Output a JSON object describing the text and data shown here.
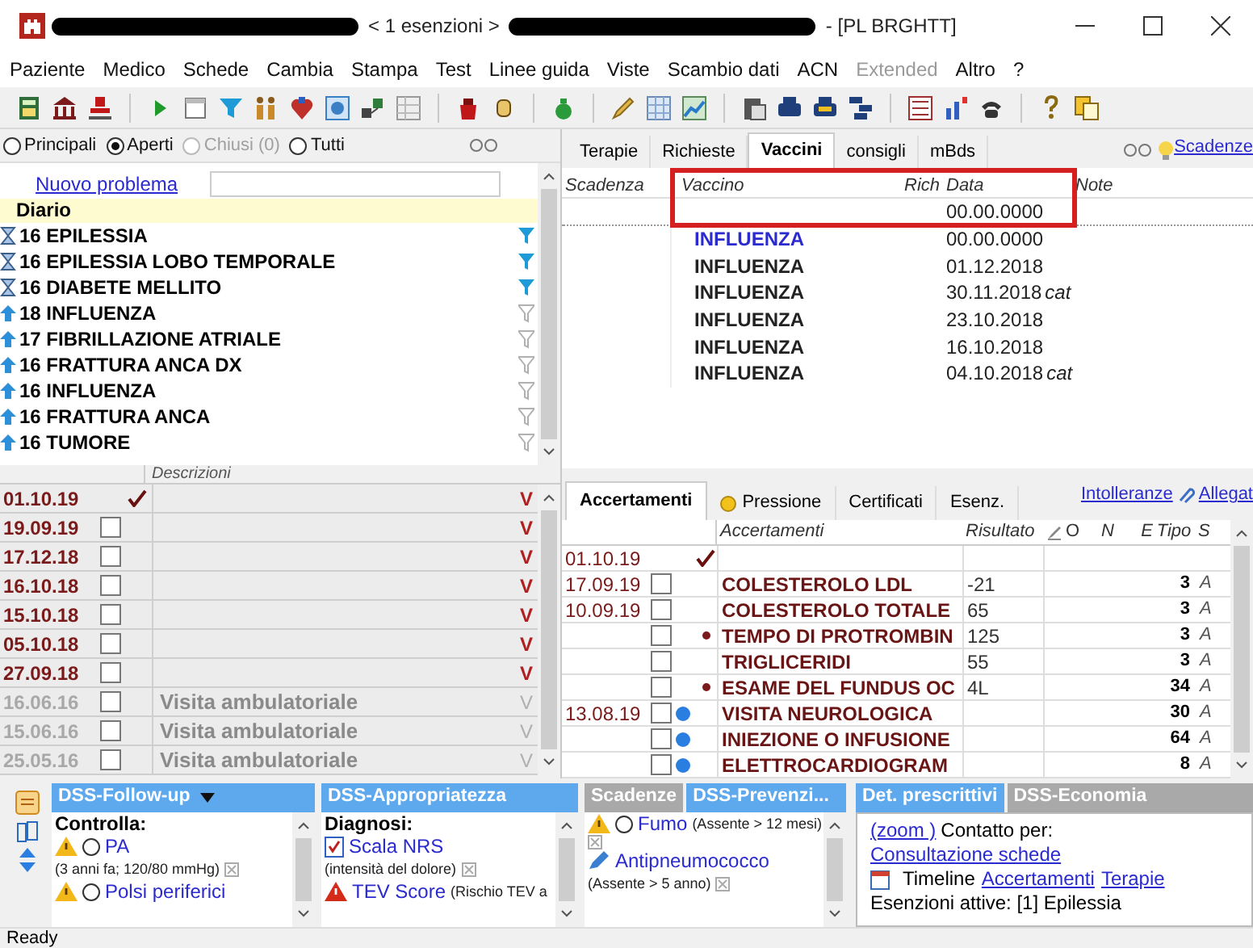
{
  "title_bar": {
    "parts": [
      {
        "kind": "redacted"
      },
      {
        "kind": "text",
        "text": "< 1 esenzioni >"
      },
      {
        "kind": "redacted"
      },
      {
        "kind": "text",
        "text": "- [PL BRGHTT]"
      }
    ]
  },
  "menu": [
    {
      "label": "Paziente",
      "disabled": false
    },
    {
      "label": "Medico",
      "disabled": false
    },
    {
      "label": "Schede",
      "disabled": false
    },
    {
      "label": "Cambia",
      "disabled": false
    },
    {
      "label": "Stampa",
      "disabled": false
    },
    {
      "label": "Test",
      "disabled": false
    },
    {
      "label": "Linee guida",
      "disabled": false
    },
    {
      "label": "Viste",
      "disabled": false
    },
    {
      "label": "Scambio dati",
      "disabled": false
    },
    {
      "label": "ACN",
      "disabled": false
    },
    {
      "label": "Extended",
      "disabled": true
    },
    {
      "label": "Altro",
      "disabled": false
    },
    {
      "label": "?",
      "disabled": false
    }
  ],
  "filters": [
    {
      "label": "Principali",
      "selected": false,
      "disabled": false
    },
    {
      "label": "Aperti",
      "selected": true,
      "disabled": false
    },
    {
      "label": "Chiusi (0)",
      "selected": false,
      "disabled": true
    },
    {
      "label": "Tutti",
      "selected": false,
      "disabled": false
    }
  ],
  "problems": {
    "new_link": "Nuovo problema",
    "diary": "Diario",
    "items": [
      {
        "kind": "hourglass",
        "text": "16 EPILESSIA",
        "filter": true
      },
      {
        "kind": "hourglass",
        "text": "16 EPILESSIA LOBO TEMPORALE",
        "filter": true
      },
      {
        "kind": "hourglass",
        "text": "16 DIABETE MELLITO",
        "filter": true
      },
      {
        "kind": "arrow",
        "text": "18 INFLUENZA",
        "filter": false
      },
      {
        "kind": "arrow",
        "text": "17 FIBRILLAZIONE ATRIALE",
        "filter": false
      },
      {
        "kind": "arrow",
        "text": "16 FRATTURA ANCA DX",
        "filter": false
      },
      {
        "kind": "arrow",
        "text": "16 INFLUENZA",
        "filter": false
      },
      {
        "kind": "arrow",
        "text": "16 FRATTURA ANCA",
        "filter": false
      },
      {
        "kind": "arrow",
        "text": "16 TUMORE",
        "filter": false
      }
    ]
  },
  "diary": {
    "column": "Descrizioni",
    "rows": [
      {
        "date": "01.10.19",
        "checked": true,
        "dimmed": false,
        "description": "",
        "flag": "V"
      },
      {
        "date": "19.09.19",
        "checked": false,
        "dimmed": false,
        "description": "",
        "flag": "V"
      },
      {
        "date": "17.12.18",
        "checked": false,
        "dimmed": false,
        "description": "",
        "flag": "V"
      },
      {
        "date": "16.10.18",
        "checked": false,
        "dimmed": false,
        "description": "",
        "flag": "V"
      },
      {
        "date": "15.10.18",
        "checked": false,
        "dimmed": false,
        "description": "",
        "flag": "V"
      },
      {
        "date": "05.10.18",
        "checked": false,
        "dimmed": false,
        "description": "",
        "flag": "V"
      },
      {
        "date": "27.09.18",
        "checked": false,
        "dimmed": false,
        "description": "",
        "flag": "V"
      },
      {
        "date": "16.06.16",
        "checked": false,
        "dimmed": true,
        "description": "Visita ambulatoriale",
        "flag": "V"
      },
      {
        "date": "15.06.16",
        "checked": false,
        "dimmed": true,
        "description": "Visita ambulatoriale",
        "flag": "V"
      },
      {
        "date": "25.05.16",
        "checked": false,
        "dimmed": true,
        "description": "Visita ambulatoriale",
        "flag": "V"
      }
    ]
  },
  "top_tabs": [
    {
      "label": "Terapie",
      "selected": false
    },
    {
      "label": "Richieste",
      "selected": false
    },
    {
      "label": "Vaccini",
      "selected": true
    },
    {
      "label": "consigli",
      "selected": false
    },
    {
      "label": "mBds",
      "selected": false
    }
  ],
  "deadlines_link": "Scadenze",
  "vaccines": {
    "columns": [
      "Scadenza",
      "Vaccino",
      "Rich",
      "Data",
      "Note"
    ],
    "new_row_date": "00.00.0000",
    "rows": [
      {
        "vaccine": "INFLUENZA",
        "date": "00.00.0000",
        "suffix": "",
        "pending": true
      },
      {
        "vaccine": "INFLUENZA",
        "date": "01.12.2018",
        "suffix": "",
        "pending": false
      },
      {
        "vaccine": "INFLUENZA",
        "date": "30.11.2018",
        "suffix": "cat",
        "pending": false
      },
      {
        "vaccine": "INFLUENZA",
        "date": "23.10.2018",
        "suffix": "",
        "pending": false
      },
      {
        "vaccine": "INFLUENZA",
        "date": "16.10.2018",
        "suffix": "",
        "pending": false
      },
      {
        "vaccine": "INFLUENZA",
        "date": "04.10.2018",
        "suffix": "cat",
        "pending": false
      }
    ]
  },
  "bottom_tabs": [
    {
      "label": "Accertamenti",
      "selected": true,
      "dot": false
    },
    {
      "label": "Pressione",
      "selected": false,
      "dot": true
    },
    {
      "label": "Certificati",
      "selected": false,
      "dot": false
    },
    {
      "label": "Esenz.",
      "selected": false,
      "dot": false
    }
  ],
  "bottom_links": [
    "Intolleranze",
    "Allegat"
  ],
  "tests": {
    "columns": [
      "Accertamenti",
      "Risultato",
      "O",
      "N",
      "E",
      "Tipo",
      "S"
    ],
    "rows": [
      {
        "date": "01.10.19",
        "checked": true,
        "dot": false,
        "bullet": false,
        "name": "",
        "result": "",
        "type": "",
        "s": ""
      },
      {
        "date": "17.09.19",
        "checked": false,
        "dot": false,
        "bullet": false,
        "name": "COLESTEROLO LDL",
        "result": "-21",
        "type": "3",
        "s": "A"
      },
      {
        "date": "10.09.19",
        "checked": false,
        "dot": false,
        "bullet": false,
        "name": "COLESTEROLO TOTALE",
        "result": "65",
        "type": "3",
        "s": "A"
      },
      {
        "date": "",
        "checked": false,
        "dot": false,
        "bullet": true,
        "name": "TEMPO DI PROTROMBIN",
        "result": "125",
        "type": "3",
        "s": "A"
      },
      {
        "date": "",
        "checked": false,
        "dot": false,
        "bullet": false,
        "name": "TRIGLICERIDI",
        "result": "55",
        "type": "3",
        "s": "A"
      },
      {
        "date": "",
        "checked": false,
        "dot": false,
        "bullet": true,
        "name": "ESAME DEL FUNDUS OC",
        "result": "4L",
        "type": "34",
        "s": "A"
      },
      {
        "date": "13.08.19",
        "checked": false,
        "dot": true,
        "bullet": false,
        "name": "VISITA NEUROLOGICA",
        "result": "",
        "type": "30",
        "s": "A"
      },
      {
        "date": "",
        "checked": false,
        "dot": true,
        "bullet": false,
        "name": "INIEZIONE O INFUSIONE",
        "result": "",
        "type": "64",
        "s": "A"
      },
      {
        "date": "",
        "checked": false,
        "dot": true,
        "bullet": false,
        "name": "ELETTROCARDIOGRAM",
        "result": "",
        "type": "8",
        "s": "A"
      }
    ]
  },
  "dss_panels": [
    {
      "tabs": [
        {
          "label": "DSS-Follow-up",
          "selected": true,
          "caret": true
        }
      ],
      "heading": "Controlla:",
      "items": [
        {
          "kind": "warning",
          "text": "PA",
          "note": "(3 anni fa; 120/80 mmHg)",
          "dismissible": true
        },
        {
          "kind": "warning",
          "text": "Polsi periferici",
          "dismissible": false
        }
      ]
    },
    {
      "tabs": [
        {
          "label": "DSS-Appropriatezza",
          "selected": true,
          "caret": false
        }
      ],
      "heading": "Diagnosi:",
      "items": [
        {
          "kind": "checklist",
          "text": "Scala NRS",
          "note": "(intensità del dolore)",
          "dismissible": true
        },
        {
          "kind": "alert",
          "text": "TEV Score",
          "note": "(Rischio TEV a",
          "dismissible": false
        }
      ]
    },
    {
      "tabs": [
        {
          "label": "Scadenze",
          "selected": false,
          "caret": false
        },
        {
          "label": "DSS-Prevenzi...",
          "selected": true,
          "caret": false
        }
      ],
      "items": [
        {
          "kind": "warning",
          "text": "Fumo",
          "note": "(Assente > 12 mesi)",
          "dismissible": true
        },
        {
          "kind": "pen",
          "text": "Antipneumococco",
          "note": "(Assente > 5 anno)",
          "dismissible": true
        }
      ]
    }
  ],
  "prescriptions": {
    "tabs": [
      {
        "label": "Det. prescrittivi",
        "selected": true
      },
      {
        "label": "DSS-Economia",
        "selected": false
      }
    ],
    "zoom_link": "(zoom )",
    "contact_label": "Contatto per:",
    "contact_link": "Consultazione schede",
    "timeline_label": "Timeline",
    "timeline_links": [
      "Accertamenti",
      "Terapie"
    ],
    "exemptions": "Esenzioni attive: [1] Epilessia"
  },
  "status_bar": "Ready"
}
